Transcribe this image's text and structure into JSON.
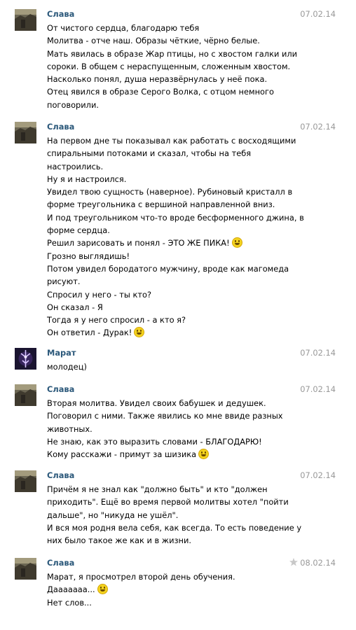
{
  "messages": [
    {
      "author": "Слава",
      "date": "07.02.14",
      "lines": [
        "От чистого сердца, благодарю тебя",
        "Молитва - отче наш. Образы чёткие, чёрно белые.",
        "Мать явилась в образе Жар птицы, но с хвостом галки или",
        "сороки. В общем с нераспущенным, сложенным хвостом.",
        "Насколько понял, душа неразвёрнулась у неё пока.",
        "Отец явился в образе Серого Волка, с отцом немного",
        "поговорили."
      ]
    },
    {
      "author": "Слава",
      "date": "07.02.14",
      "lines": [
        "На первом дне ты показывал как работать с восходящими",
        "спиральными потоками и сказал, чтобы на тебя",
        "настроились.",
        "Ну я и настроился.",
        "Увидел твою сущность (наверное). Рубиновый кристалл в",
        "форме треугольника с вершиной направленной вниз.",
        "И под треугольником что-то вроде бесформенного джина, в",
        "форме сердца.",
        "Решил зарисовать и понял - ЭТО ЖЕ ПИКА!",
        "Грозно выглядишь!",
        "Потом увидел бородатого мужчину, вроде как магомеда",
        "рисуют.",
        "Спросил у него - ты кто?",
        "Он сказал - Я",
        "Тогда я у него спросил - а кто я?",
        "Он ответил - Дурак!"
      ]
    },
    {
      "author": "Марат",
      "date": "07.02.14",
      "lines": [
        "молодец)"
      ]
    },
    {
      "author": "Слава",
      "date": "07.02.14",
      "lines": [
        "Вторая молитва. Увидел своих бабушек и дедушек.",
        "Поговорил с ними. Также явились ко мне ввиде разных",
        "животных.",
        "Не знаю, как это выразить словами - БЛАГОДАРЮ!",
        "Кому расскажи - примут за шизика"
      ]
    },
    {
      "author": "Слава",
      "date": "07.02.14",
      "lines": [
        "Причём я не знал как \"должно быть\" и кто \"должен",
        "приходить\". Ещё во время первой молитвы хотел \"пойти",
        "дальше\", но \"никуда не ушёл\".",
        "И вся моя родня вела себя, как всегда. То есть поведение у",
        "них было такое же как и в жизни."
      ]
    },
    {
      "author": "Слава",
      "date": "08.02.14",
      "lines": [
        "Марат, я просмотрел второй день обучения.",
        "Дааааааа...",
        "Нет слов..."
      ]
    }
  ]
}
